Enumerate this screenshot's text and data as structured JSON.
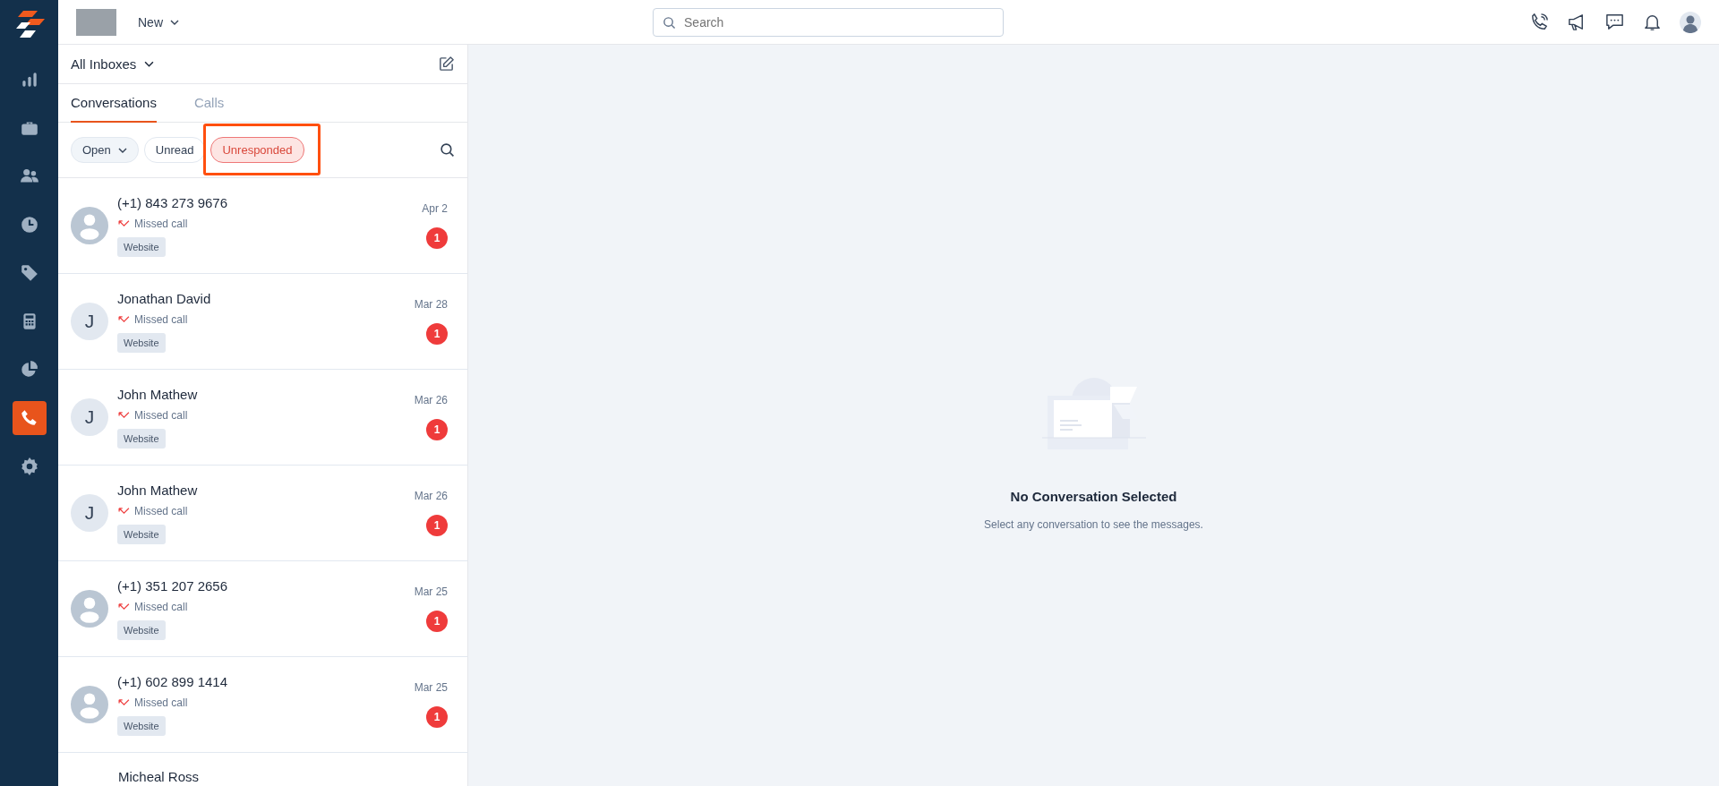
{
  "nav": [
    {
      "kind": "chart",
      "selected": false
    },
    {
      "kind": "briefcase",
      "selected": false
    },
    {
      "kind": "users",
      "selected": false
    },
    {
      "kind": "clock",
      "selected": false
    },
    {
      "kind": "tag",
      "selected": false
    },
    {
      "kind": "calculator",
      "selected": false
    },
    {
      "kind": "pie",
      "selected": false
    },
    {
      "kind": "phone",
      "selected": true
    },
    {
      "kind": "gear",
      "selected": false
    }
  ],
  "topbar": {
    "new_menu": "New",
    "search": {
      "placeholder": "Search"
    },
    "actions": [
      {
        "kind": "phone"
      },
      {
        "kind": "megaphone"
      },
      {
        "kind": "chat"
      },
      {
        "kind": "bell"
      }
    ]
  },
  "inbox_selector": "All Inboxes",
  "tabs": [
    {
      "label": "Conversations",
      "selected": true
    },
    {
      "label": "Calls",
      "selected": false
    }
  ],
  "filters": [
    {
      "label": "Open",
      "kind": "dropdown",
      "selected": false,
      "highlighted": false
    },
    {
      "label": "Unread",
      "kind": "chip",
      "selected": false,
      "highlighted": false
    },
    {
      "label": "Unresponded",
      "kind": "chip",
      "selected": true,
      "highlighted": true
    }
  ],
  "conversations": [
    {
      "name": "(+1) 843 273 9676",
      "avatar": {
        "kind": "person"
      },
      "status": "Missed call",
      "source": "Website",
      "date": "Apr 2",
      "unread": "1"
    },
    {
      "name": "Jonathan David",
      "avatar": {
        "kind": "initial",
        "letter": "J"
      },
      "status": "Missed call",
      "source": "Website",
      "date": "Mar 28",
      "unread": "1"
    },
    {
      "name": "John Mathew",
      "avatar": {
        "kind": "initial",
        "letter": "J"
      },
      "status": "Missed call",
      "source": "Website",
      "date": "Mar 26",
      "unread": "1"
    },
    {
      "name": "John Mathew",
      "avatar": {
        "kind": "initial",
        "letter": "J"
      },
      "status": "Missed call",
      "source": "Website",
      "date": "Mar 26",
      "unread": "1"
    },
    {
      "name": "(+1) 351 207 2656",
      "avatar": {
        "kind": "person"
      },
      "status": "Missed call",
      "source": "Website",
      "date": "Mar 25",
      "unread": "1"
    },
    {
      "name": "(+1) 602 899 1414",
      "avatar": {
        "kind": "person"
      },
      "status": "Missed call",
      "source": "Website",
      "date": "Mar 25",
      "unread": "1"
    },
    {
      "name": "Micheal Ross"
    }
  ],
  "empty_state": {
    "title": "No Conversation Selected",
    "message": "Select any conversation to see the messages."
  }
}
